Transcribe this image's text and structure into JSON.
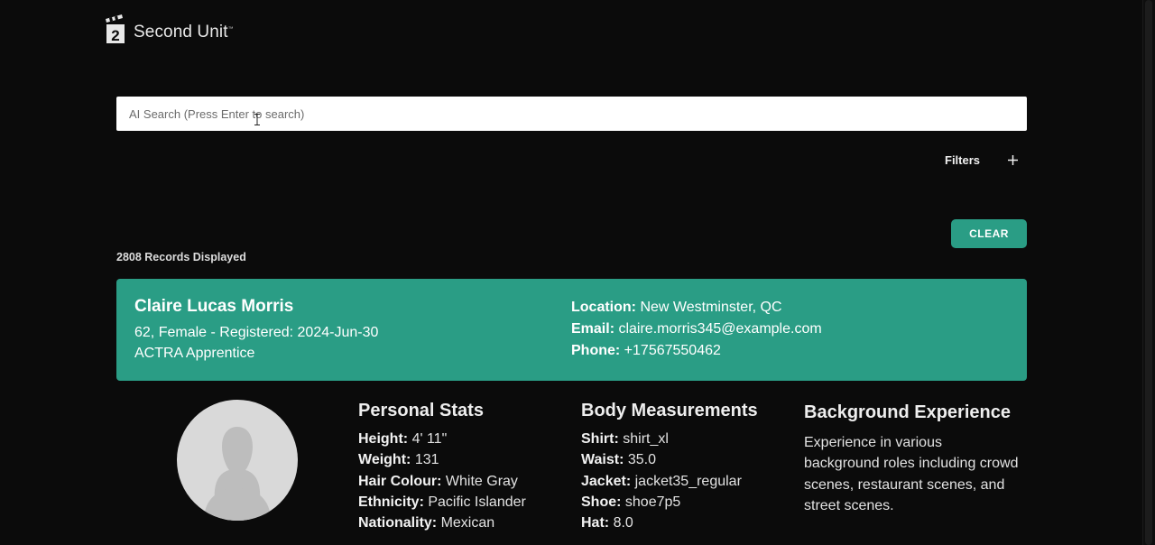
{
  "app": {
    "brand": "Second Unit",
    "brand_mark": "™",
    "logo_number": "2"
  },
  "search": {
    "placeholder": "AI Search (Press Enter to search)",
    "value": ""
  },
  "filters": {
    "label": "Filters"
  },
  "clear_label": "CLEAR",
  "records_label": "2808 Records Displayed",
  "profile": {
    "name": "Claire Lucas Morris",
    "summary": "62, Female - Registered: 2024-Jun-30",
    "membership": "ACTRA Apprentice",
    "location_label": "Location:",
    "location": "New Westminster, QC",
    "email_label": "Email:",
    "email": "claire.morris345@example.com",
    "phone_label": "Phone:",
    "phone": "+17567550462"
  },
  "personal_stats": {
    "title": "Personal Stats",
    "rows": [
      {
        "label": "Height:",
        "value": "4' 11\""
      },
      {
        "label": "Weight:",
        "value": "131"
      },
      {
        "label": "Hair Colour:",
        "value": "White Gray"
      },
      {
        "label": "Ethnicity:",
        "value": "Pacific Islander"
      },
      {
        "label": "Nationality:",
        "value": "Mexican"
      }
    ]
  },
  "body_measurements": {
    "title": "Body Measurements",
    "rows": [
      {
        "label": "Shirt:",
        "value": "shirt_xl"
      },
      {
        "label": "Waist:",
        "value": "35.0"
      },
      {
        "label": "Jacket:",
        "value": "jacket35_regular"
      },
      {
        "label": "Shoe:",
        "value": "shoe7p5"
      },
      {
        "label": "Hat:",
        "value": "8.0"
      }
    ]
  },
  "background": {
    "title": "Background Experience",
    "description": "Experience in various background roles including crowd scenes, restaurant scenes, and street scenes."
  },
  "colors": {
    "accent": "#2a9d85",
    "background": "#0b0b0b",
    "avatar_bg": "#d9d9d9"
  },
  "icons": {
    "logo": "clapperboard-icon",
    "filters_toggle": "plus-icon",
    "avatar": "person-silhouette-icon",
    "cursor": "text-cursor-icon"
  }
}
